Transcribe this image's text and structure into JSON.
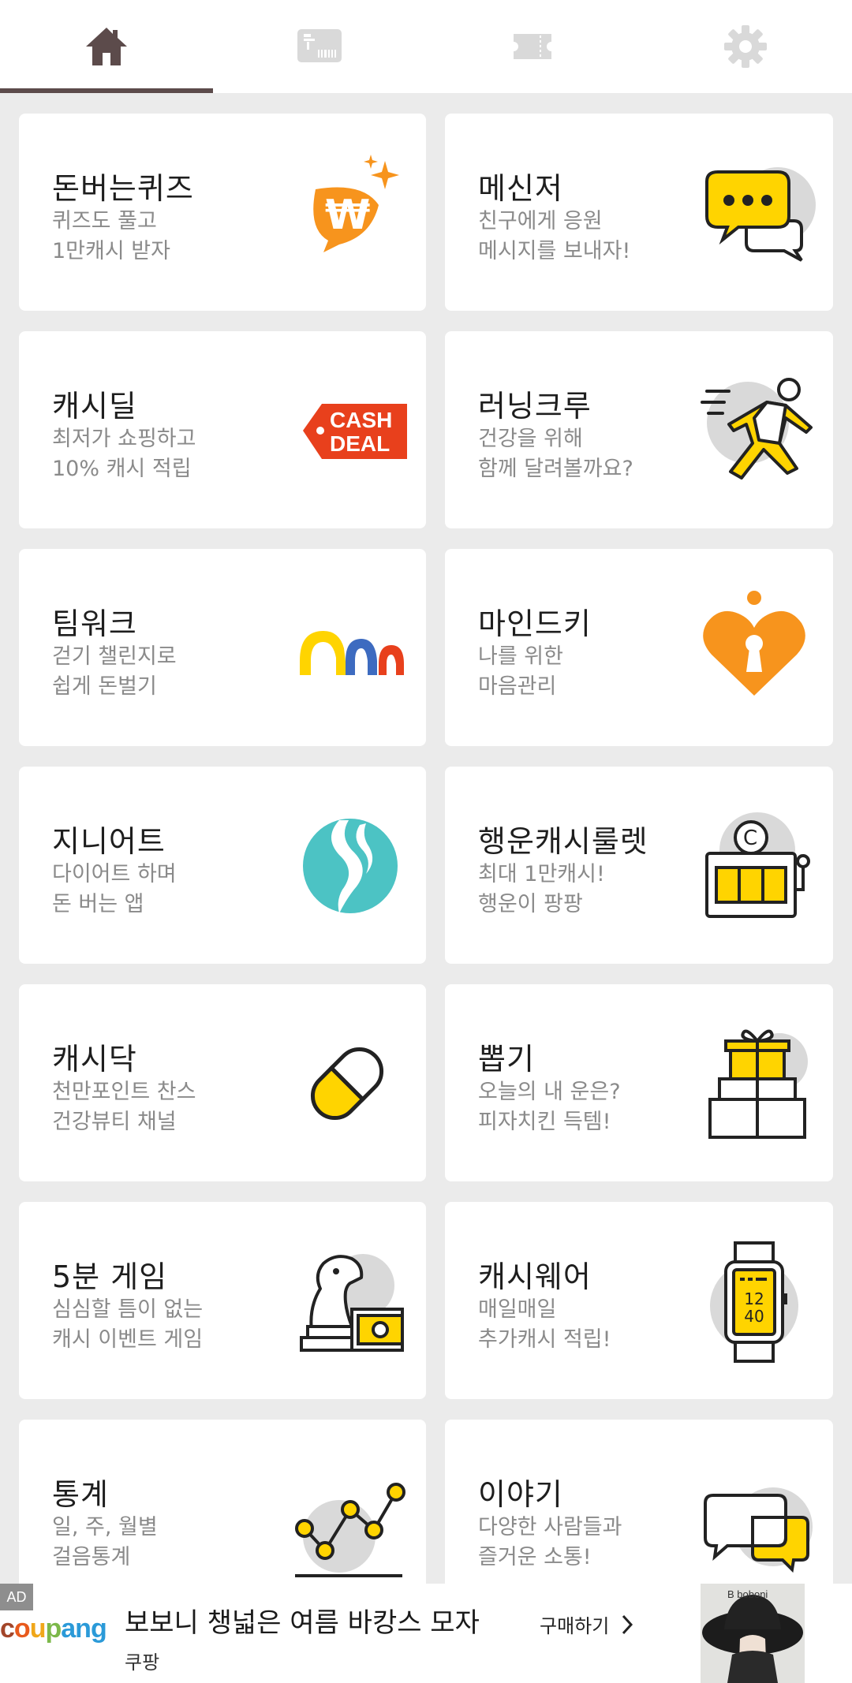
{
  "tabs": [
    {
      "name": "home",
      "icon": "home-icon",
      "active": true
    },
    {
      "name": "coupon",
      "icon": "coupon-card-icon",
      "active": false
    },
    {
      "name": "ticket",
      "icon": "ticket-icon",
      "active": false
    },
    {
      "name": "settings",
      "icon": "gear-icon",
      "active": false
    }
  ],
  "colors": {
    "accent_underline": "#5c4b4b",
    "yellow": "#ffd400",
    "orange": "#f7941d",
    "red": "#e8401c",
    "teal": "#4cc3c4",
    "blue": "#3d6bc0",
    "inactive_icon": "#d9d9d9"
  },
  "cards": [
    {
      "title": "돈버는퀴즈",
      "subtitle": "퀴즈도 풀고\n1만캐시 받자",
      "icon": "won-coin-sparkle-icon"
    },
    {
      "title": "메신저",
      "subtitle": "친구에게 응원\n메시지를 보내자!",
      "icon": "chat-bubble-icon"
    },
    {
      "title": "캐시딜",
      "subtitle": "최저가 쇼핑하고\n10% 캐시 적립",
      "icon": "cash-deal-tag-icon",
      "tag_text": [
        "CASH",
        "DEAL"
      ]
    },
    {
      "title": "러닝크루",
      "subtitle": "건강을 위해\n함께 달려볼까요?",
      "icon": "runner-icon"
    },
    {
      "title": "팀워크",
      "subtitle": "걷기 챌린지로\n쉽게 돈벌기",
      "icon": "teamwork-arches-icon"
    },
    {
      "title": "마인드키",
      "subtitle": "나를 위한\n마음관리",
      "icon": "heart-keyhole-icon"
    },
    {
      "title": "지니어트",
      "subtitle": "다이어트 하며\n돈 버는 앱",
      "icon": "genieat-logo-icon"
    },
    {
      "title": "행운캐시룰렛",
      "subtitle": "최대 1만캐시!\n행운이 팡팡",
      "icon": "slot-machine-icon"
    },
    {
      "title": "캐시닥",
      "subtitle": "천만포인트 찬스\n건강뷰티 채널",
      "icon": "pill-capsule-icon"
    },
    {
      "title": "뽑기",
      "subtitle": "오늘의 내 운은?\n피자치킨 득템!",
      "icon": "gift-boxes-icon"
    },
    {
      "title": "5분 게임",
      "subtitle": "심심할 틈이 없는\n캐시 이벤트 게임",
      "icon": "chess-knight-money-icon"
    },
    {
      "title": "캐시웨어",
      "subtitle": "매일매일\n추가캐시 적립!",
      "icon": "smartwatch-icon",
      "watch_text": [
        "12",
        "40"
      ]
    },
    {
      "title": "통계",
      "subtitle": "일, 주, 월별\n걸음통계",
      "icon": "line-graph-icon"
    },
    {
      "title": "이야기",
      "subtitle": "다양한 사람들과\n즐거운 소통!",
      "icon": "chat-bubbles-icon"
    }
  ],
  "ad": {
    "badge": "AD",
    "brand": "coupang",
    "title": "보보니 챙넓은 여름 바캉스 모자",
    "subtitle": "쿠팡",
    "cta": "구매하기",
    "image_label": "B boboni"
  }
}
